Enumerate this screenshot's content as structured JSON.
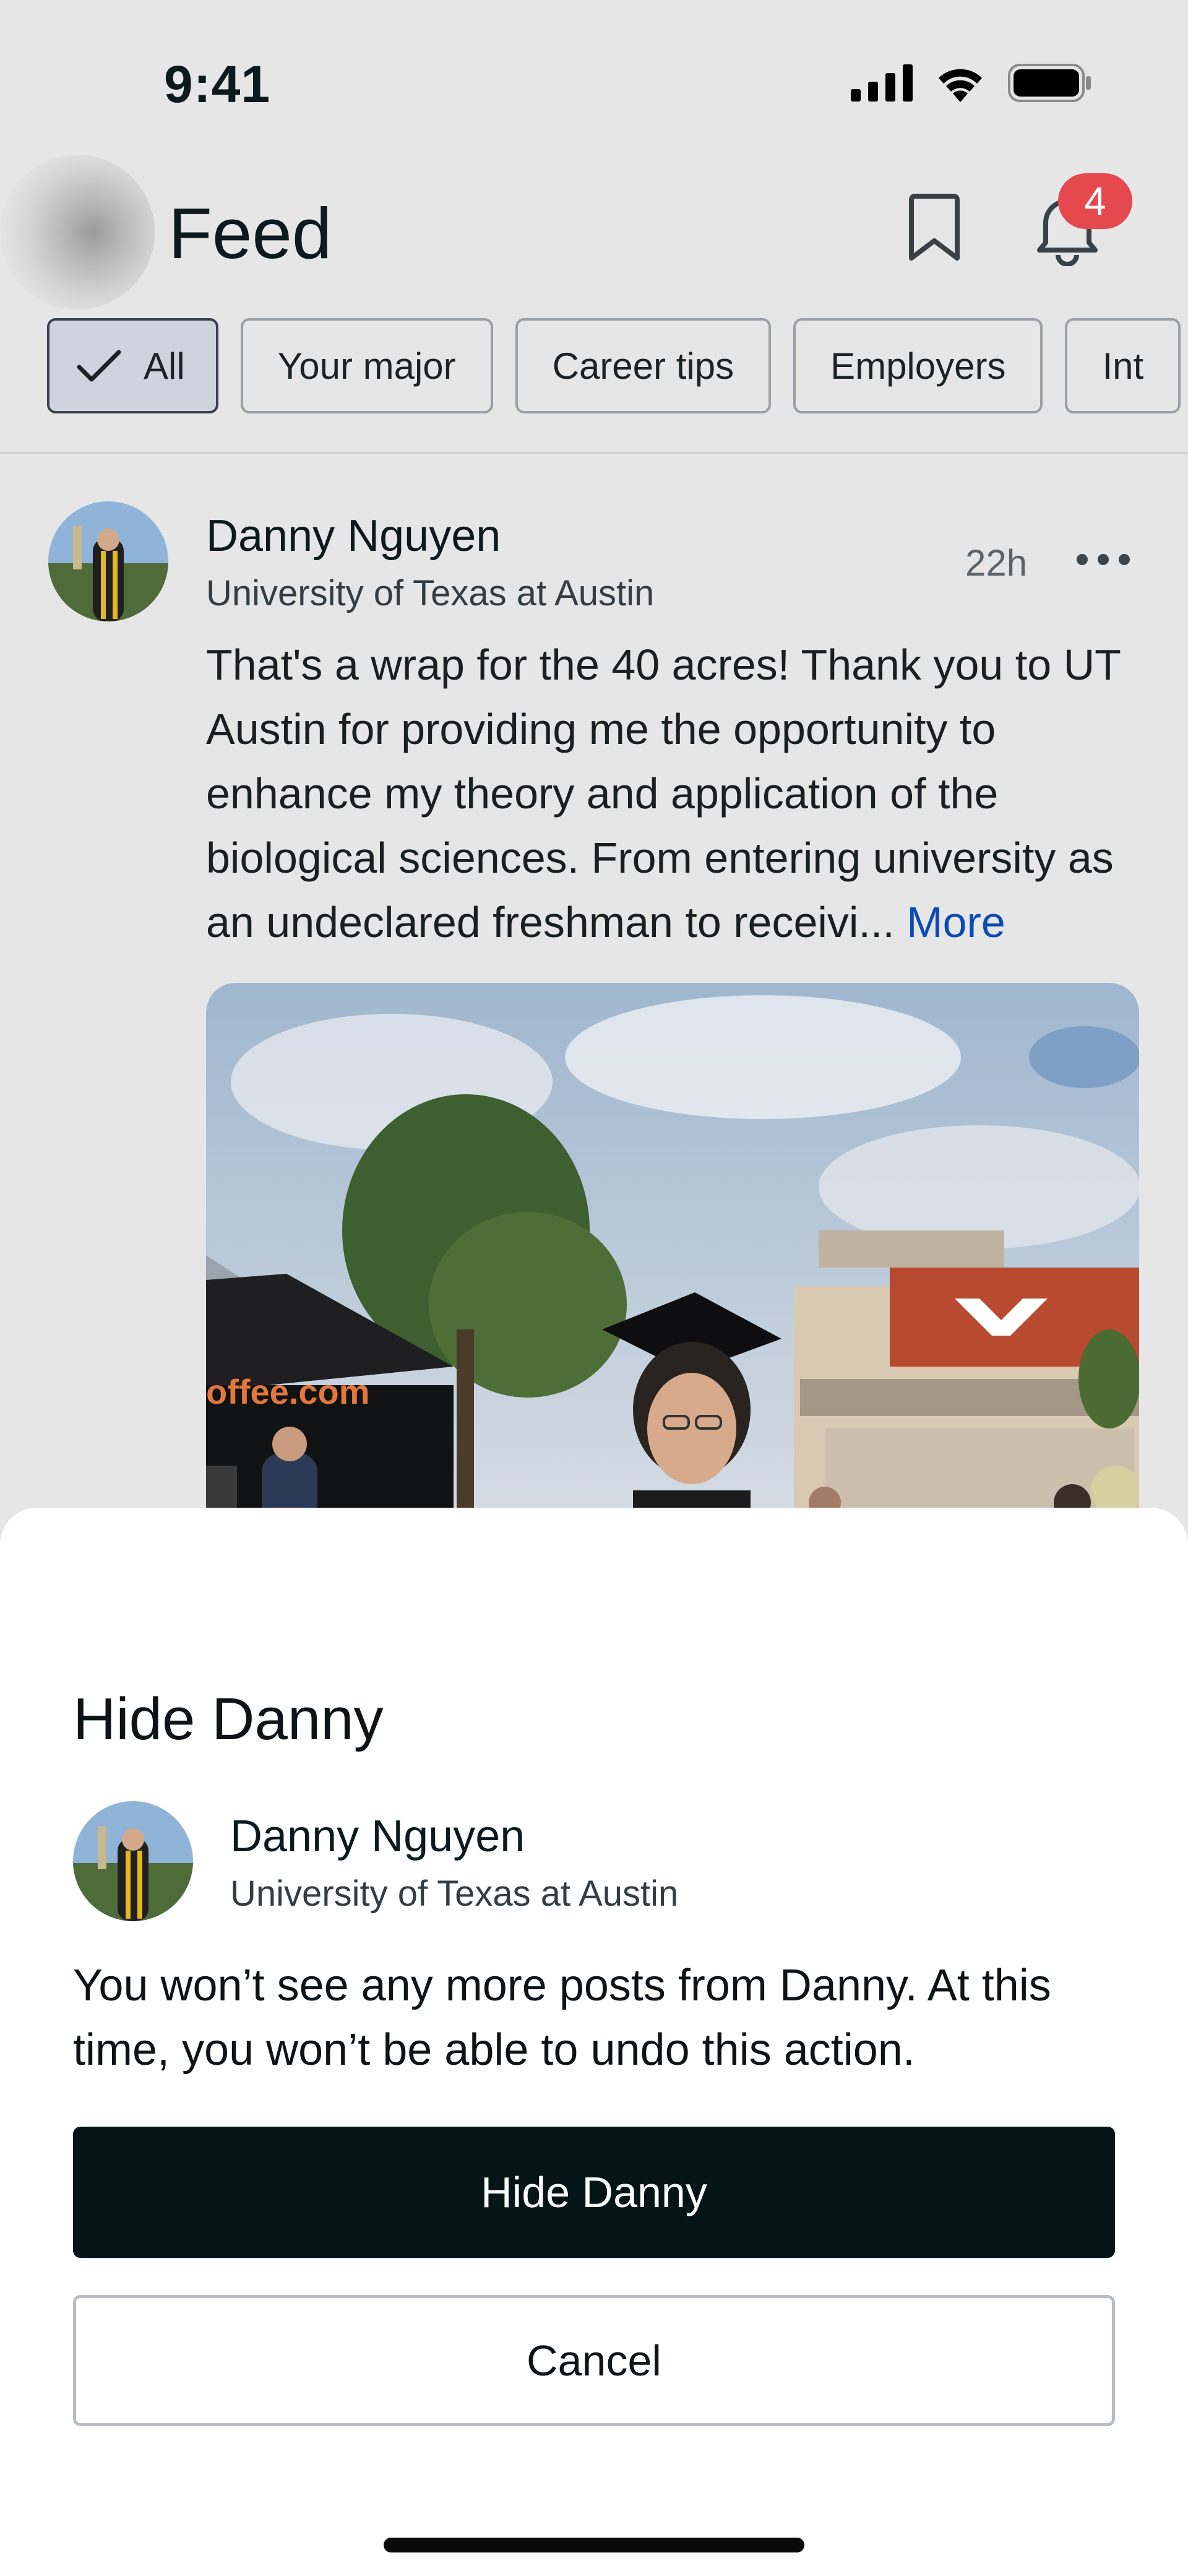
{
  "status_bar": {
    "time": "9:41"
  },
  "header": {
    "title": "Feed",
    "notification_count": "4"
  },
  "filters": [
    {
      "label": "All",
      "active": true
    },
    {
      "label": "Your major"
    },
    {
      "label": "Career tips"
    },
    {
      "label": "Employers"
    },
    {
      "label": "Int"
    }
  ],
  "post": {
    "author": "Danny Nguyen",
    "school": "University of Texas at Austin",
    "time": "22h",
    "body": "That's a wrap for the 40 acres! Thank you to UT Austin for providing me the opportunity to enhance my theory and application of the biological sciences. From entering university as an undeclared freshman to receivi...",
    "more_label": "More",
    "photo_banner_text": "offee.com"
  },
  "sheet": {
    "title": "Hide Danny",
    "author": "Danny Nguyen",
    "school": "University of Texas at Austin",
    "message": "You won’t see any more posts from Danny. At this time, you won’t be able to undo this action.",
    "confirm_label": "Hide Danny",
    "cancel_label": "Cancel"
  },
  "colors": {
    "badge": "#e5484d",
    "link": "#0a4bb5",
    "primary_button": "#051417"
  }
}
